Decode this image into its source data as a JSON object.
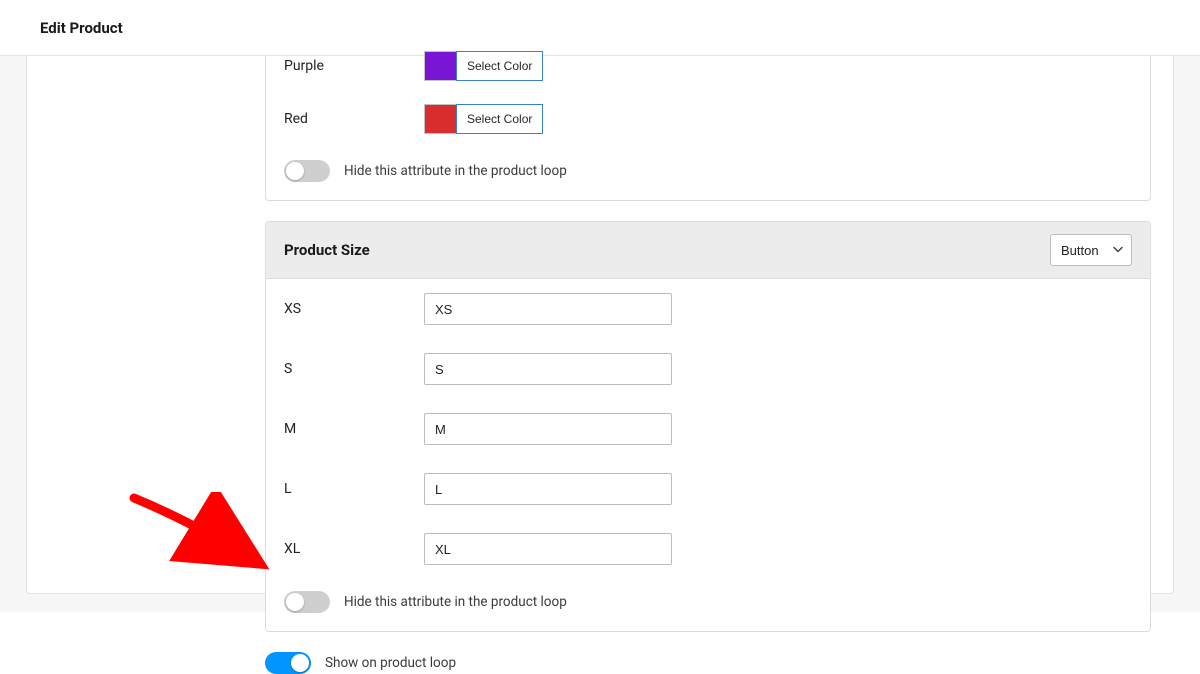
{
  "header": {
    "title": "Edit Product"
  },
  "colorAttr": {
    "rows": [
      {
        "label": "Purple",
        "swatch": "#7b15d6",
        "button": "Select Color"
      },
      {
        "label": "Red",
        "swatch": "#d82e2e",
        "button": "Select Color"
      }
    ],
    "hideToggle": {
      "on": false,
      "label": "Hide this attribute in the product loop"
    }
  },
  "sizeAttr": {
    "title": "Product Size",
    "typeSelect": {
      "value": "Button"
    },
    "rows": [
      {
        "label": "XS",
        "value": "XS"
      },
      {
        "label": "S",
        "value": "S"
      },
      {
        "label": "M",
        "value": "M"
      },
      {
        "label": "L",
        "value": "L"
      },
      {
        "label": "XL",
        "value": "XL"
      }
    ],
    "hideToggle": {
      "on": false,
      "label": "Hide this attribute in the product loop"
    }
  },
  "showLoop": {
    "on": true,
    "label": "Show on product loop"
  }
}
